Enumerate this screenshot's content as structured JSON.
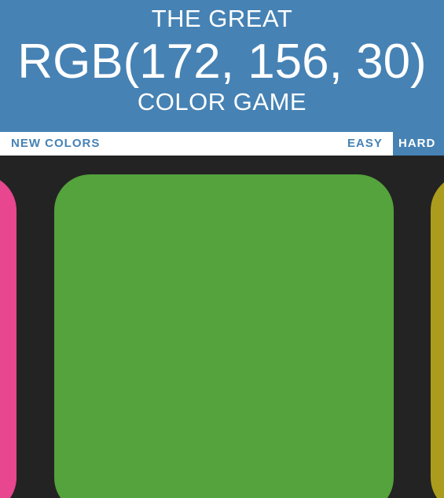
{
  "header": {
    "title_line1": "THE GREAT",
    "rgb_display": "RGB(172, 156, 30)",
    "title_line2": "COLOR GAME",
    "background_color": "#4682b4"
  },
  "stripe": {
    "new_colors_label": "NEW COLORS",
    "easy_label": "EASY",
    "hard_label": "HARD",
    "selected_mode": "HARD"
  },
  "board": {
    "background_color": "#232323",
    "squares": [
      {
        "color": "#e8468e"
      },
      {
        "color": "#54a33c"
      },
      {
        "color": "#ac9c1e"
      }
    ]
  }
}
